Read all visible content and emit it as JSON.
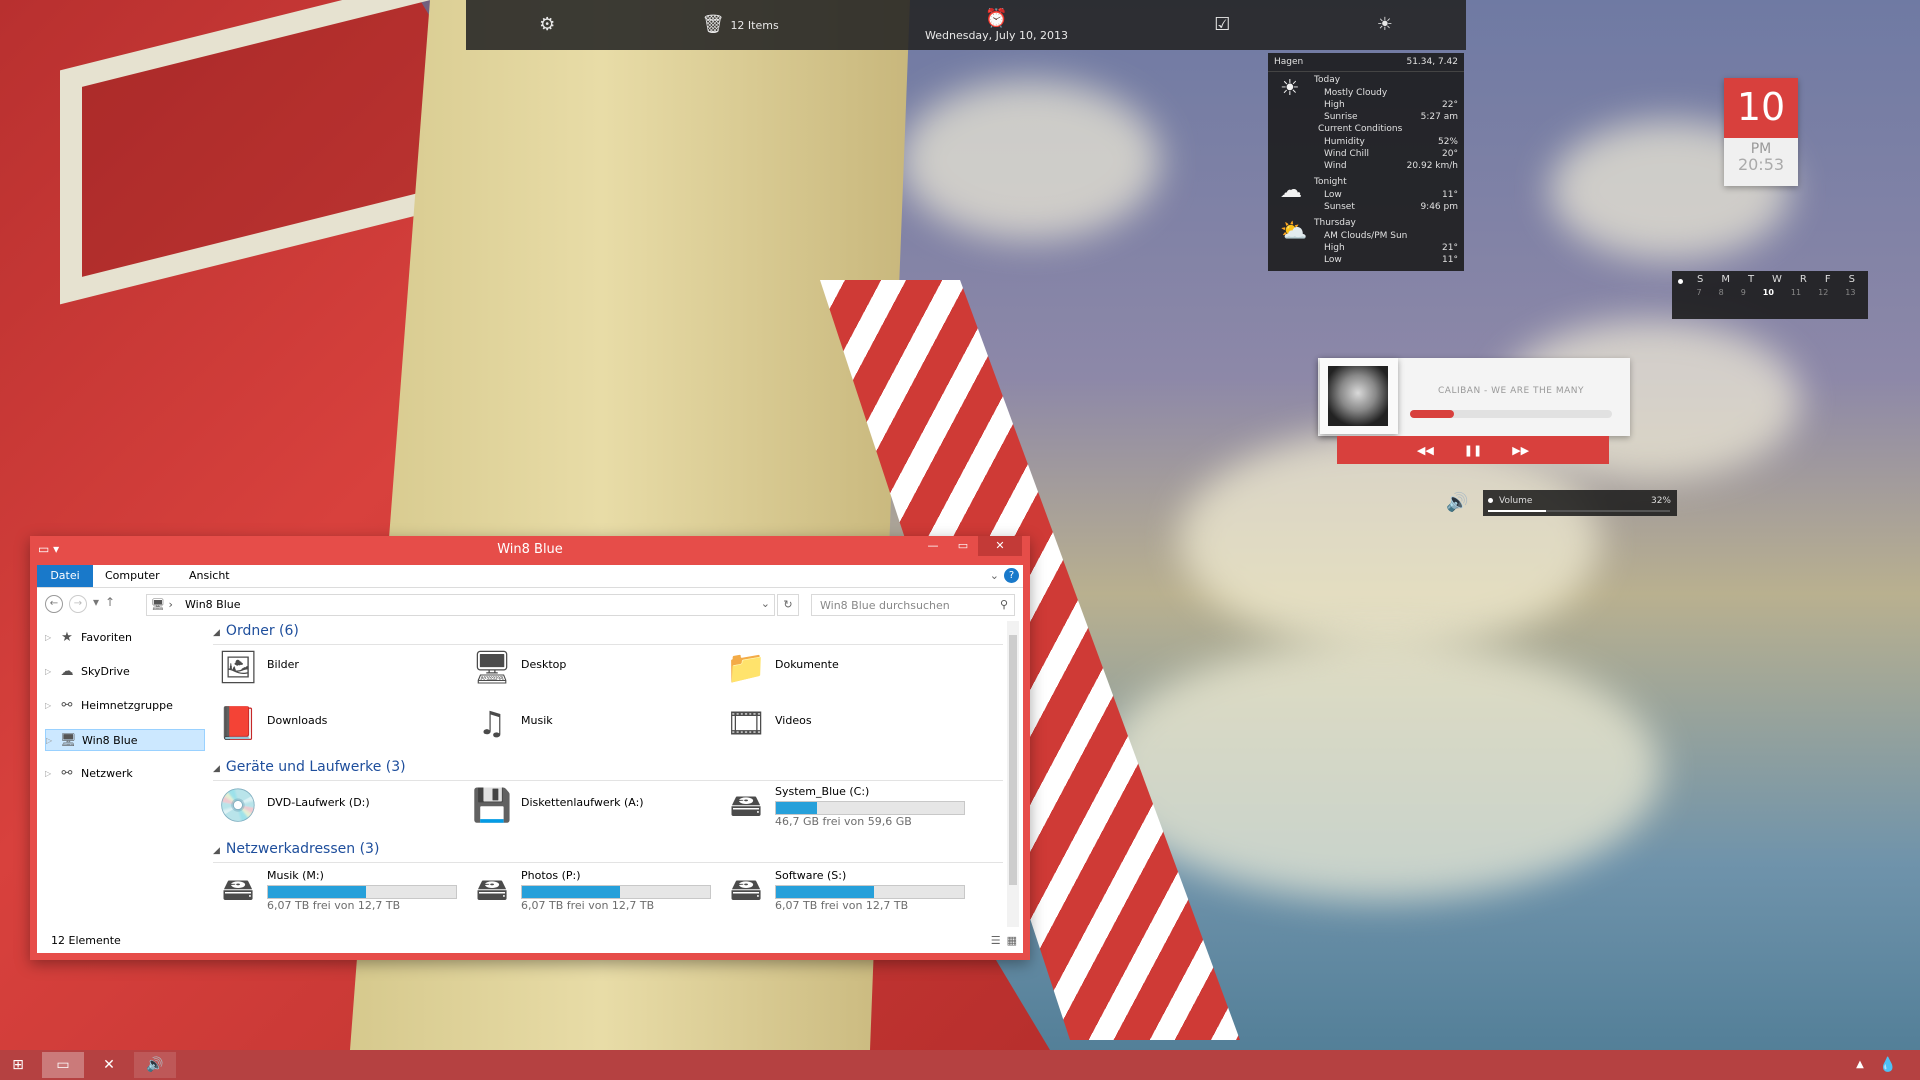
{
  "topbar": {
    "settings_icon": "gear-icon",
    "items_label": "12 Items",
    "date_label": "Wednesday, July 10, 2013",
    "tasks_icon": "checkbox-icon",
    "weather_icon": "sunrise-icon"
  },
  "weather": {
    "location": "Hagen",
    "coords": "51.34, 7.42",
    "today": "Today",
    "condition": "Mostly Cloudy",
    "high_label": "High",
    "high_val": "22°",
    "sunrise_label": "Sunrise",
    "sunrise_val": "5:27 am",
    "current": "Current Conditions",
    "humidity_label": "Humidity",
    "humidity_val": "52%",
    "windchill_label": "Wind Chill",
    "windchill_val": "20°",
    "wind_label": "Wind",
    "wind_val": "20.92 km/h",
    "tonight": "Tonight",
    "low_label": "Low",
    "low_val": "11°",
    "sunset_label": "Sunset",
    "sunset_val": "9:46 pm",
    "thursday": "Thursday",
    "thu_condition": "AM Clouds/PM Sun",
    "thu_high_label": "High",
    "thu_high_val": "21°",
    "thu_low_label": "Low",
    "thu_low_val": "11°"
  },
  "clock": {
    "day": "10",
    "ampm": "PM",
    "time": "20:53"
  },
  "calendar": {
    "weekdays": [
      "S",
      "M",
      "T",
      "W",
      "R",
      "F",
      "S"
    ],
    "days": [
      "7",
      "8",
      "9",
      "10",
      "11",
      "12",
      "13"
    ],
    "today_index": 3
  },
  "music": {
    "title": "CALIBAN - WE ARE THE MANY",
    "progress": 0.22
  },
  "volume": {
    "label": "Volume",
    "value": "32%",
    "fraction": 0.32
  },
  "explorer": {
    "title": "Win8 Blue",
    "ribbon": {
      "file": "Datei",
      "computer": "Computer",
      "view": "Ansicht",
      "help": "?"
    },
    "address": "Win8 Blue",
    "search_placeholder": "Win8 Blue durchsuchen",
    "nav": [
      "Favoriten",
      "SkyDrive",
      "Heimnetzgruppe",
      "Win8 Blue",
      "Netzwerk"
    ],
    "groups": {
      "folders": "Ordner (6)",
      "drives": "Geräte und Laufwerke (3)",
      "network": "Netzwerkadressen (3)"
    },
    "folders": [
      "Bilder",
      "Desktop",
      "Dokumente",
      "Downloads",
      "Musik",
      "Videos"
    ],
    "devices": {
      "dvd": "DVD-Laufwerk (D:)",
      "floppy": "Diskettenlaufwerk (A:)",
      "system": "System_Blue (C:)",
      "system_free": "46,7 GB frei von 59,6 GB",
      "system_used": 0.22
    },
    "netdrives": [
      {
        "name": "Musik (M:)",
        "free": "6,07 TB frei von 12,7 TB",
        "used": 0.52
      },
      {
        "name": "Photos (P:)",
        "free": "6,07 TB frei von 12,7 TB",
        "used": 0.52
      },
      {
        "name": "Software (S:)",
        "free": "6,07 TB frei von 12,7 TB",
        "used": 0.52
      }
    ],
    "status": "12 Elemente"
  },
  "colors": {
    "accent": "#e64d49",
    "blue": "#26a0da"
  }
}
